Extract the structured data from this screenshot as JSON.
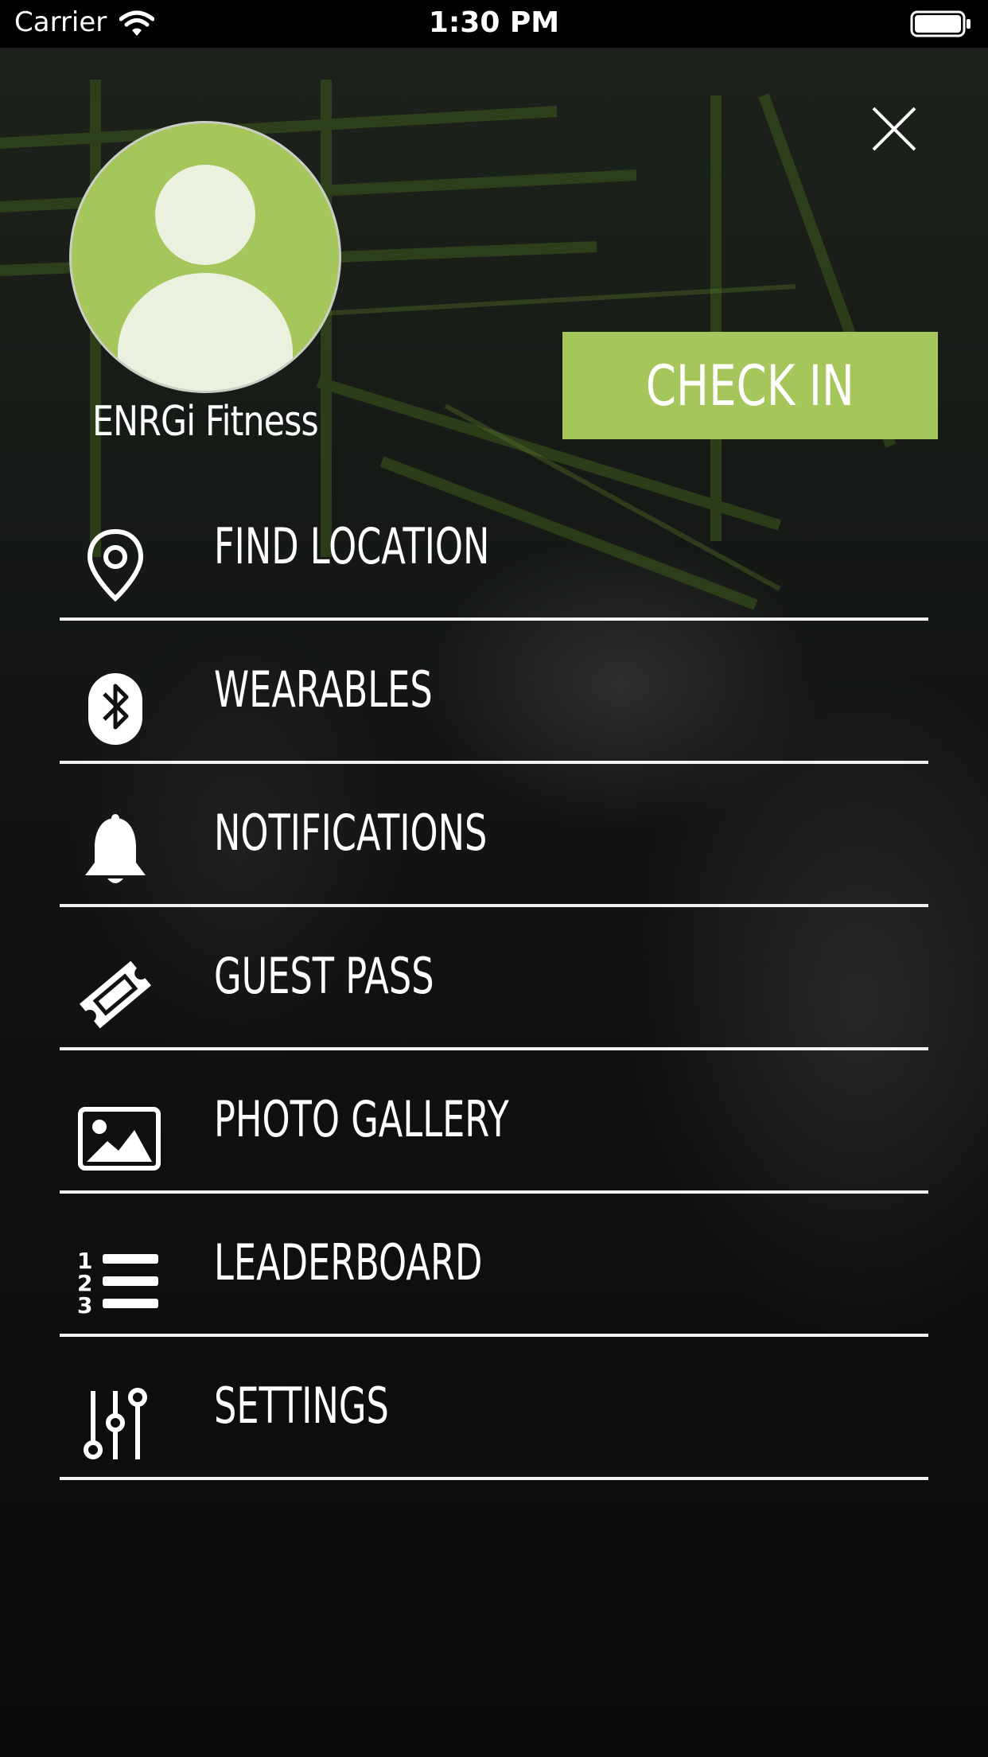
{
  "status_bar": {
    "carrier": "Carrier",
    "time": "1:30 PM"
  },
  "profile": {
    "name": "ENRGi Fitness"
  },
  "check_in": {
    "label": "CHECK IN"
  },
  "menu": {
    "items": [
      {
        "label": "FIND LOCATION",
        "icon": "location-pin-icon"
      },
      {
        "label": "WEARABLES",
        "icon": "bluetooth-icon"
      },
      {
        "label": "NOTIFICATIONS",
        "icon": "bell-icon"
      },
      {
        "label": "GUEST PASS",
        "icon": "ticket-icon"
      },
      {
        "label": "PHOTO GALLERY",
        "icon": "image-icon"
      },
      {
        "label": "LEADERBOARD",
        "icon": "ordered-list-icon"
      },
      {
        "label": "SETTINGS",
        "icon": "sliders-icon"
      }
    ]
  },
  "colors": {
    "accent": "#a4c65a",
    "divider": "#f2f2f2",
    "text": "#ffffff"
  }
}
